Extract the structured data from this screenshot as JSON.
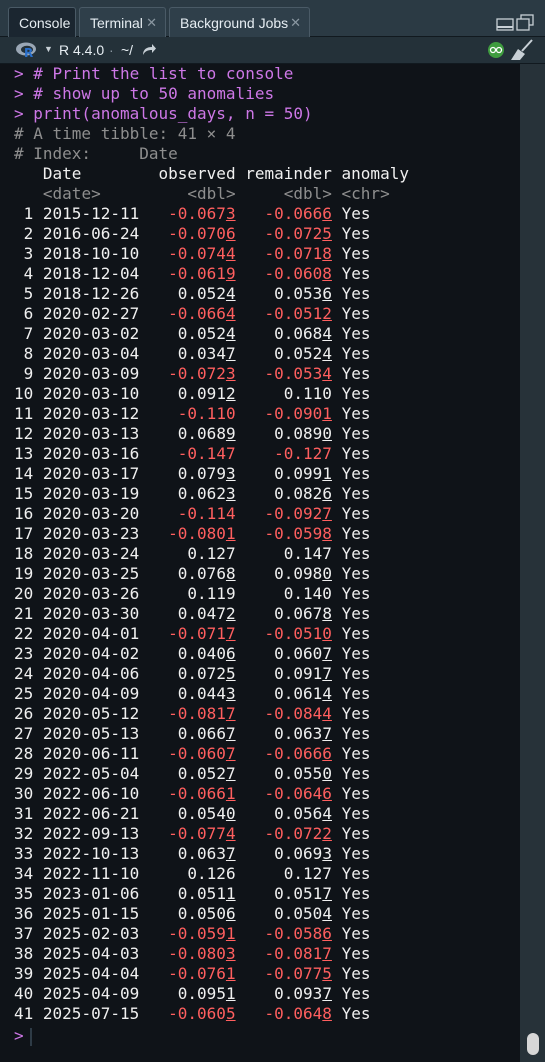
{
  "tabs": [
    {
      "label": "Console",
      "closable": false
    },
    {
      "label": "Terminal",
      "closable": true
    },
    {
      "label": "Background Jobs",
      "closable": true
    }
  ],
  "toolbar": {
    "version": "R 4.4.0",
    "separator": "·",
    "path": "~/"
  },
  "console": {
    "prompt": ">",
    "commands": [
      "# Print the list to console",
      "# show up to 50 anomalies",
      "print(anomalous_days, n = 50)"
    ],
    "meta": [
      "# A time tibble: 41 × 4",
      "# Index:     Date"
    ],
    "headers": [
      "Date",
      "observed",
      "remainder",
      "anomaly"
    ],
    "types": [
      "<date>",
      "<dbl>",
      "<dbl>",
      "<chr>"
    ],
    "rows": [
      [
        "2015-12-11",
        "-0.0673",
        "-0.0666",
        "Yes"
      ],
      [
        "2016-06-24",
        "-0.0706",
        "-0.0725",
        "Yes"
      ],
      [
        "2018-10-10",
        "-0.0744",
        "-0.0718",
        "Yes"
      ],
      [
        "2018-12-04",
        "-0.0619",
        "-0.0608",
        "Yes"
      ],
      [
        "2018-12-26",
        "0.0524",
        "0.0536",
        "Yes"
      ],
      [
        "2020-02-27",
        "-0.0664",
        "-0.0512",
        "Yes"
      ],
      [
        "2020-03-02",
        "0.0524",
        "0.0684",
        "Yes"
      ],
      [
        "2020-03-04",
        "0.0347",
        "0.0524",
        "Yes"
      ],
      [
        "2020-03-09",
        "-0.0723",
        "-0.0534",
        "Yes"
      ],
      [
        "2020-03-10",
        "0.0912",
        "0.110",
        "Yes"
      ],
      [
        "2020-03-12",
        "-0.110",
        "-0.0901",
        "Yes"
      ],
      [
        "2020-03-13",
        "0.0689",
        "0.0890",
        "Yes"
      ],
      [
        "2020-03-16",
        "-0.147",
        "-0.127",
        "Yes"
      ],
      [
        "2020-03-17",
        "0.0793",
        "0.0991",
        "Yes"
      ],
      [
        "2020-03-19",
        "0.0623",
        "0.0826",
        "Yes"
      ],
      [
        "2020-03-20",
        "-0.114",
        "-0.0927",
        "Yes"
      ],
      [
        "2020-03-23",
        "-0.0801",
        "-0.0598",
        "Yes"
      ],
      [
        "2020-03-24",
        "0.127",
        "0.147",
        "Yes"
      ],
      [
        "2020-03-25",
        "0.0768",
        "0.0980",
        "Yes"
      ],
      [
        "2020-03-26",
        "0.119",
        "0.140",
        "Yes"
      ],
      [
        "2020-03-30",
        "0.0472",
        "0.0678",
        "Yes"
      ],
      [
        "2020-04-01",
        "-0.0717",
        "-0.0510",
        "Yes"
      ],
      [
        "2020-04-02",
        "0.0406",
        "0.0607",
        "Yes"
      ],
      [
        "2020-04-06",
        "0.0725",
        "0.0917",
        "Yes"
      ],
      [
        "2020-04-09",
        "0.0443",
        "0.0614",
        "Yes"
      ],
      [
        "2020-05-12",
        "-0.0817",
        "-0.0844",
        "Yes"
      ],
      [
        "2020-05-13",
        "0.0667",
        "0.0637",
        "Yes"
      ],
      [
        "2020-06-11",
        "-0.0607",
        "-0.0666",
        "Yes"
      ],
      [
        "2022-05-04",
        "0.0527",
        "0.0550",
        "Yes"
      ],
      [
        "2022-06-10",
        "-0.0661",
        "-0.0646",
        "Yes"
      ],
      [
        "2022-06-21",
        "0.0540",
        "0.0564",
        "Yes"
      ],
      [
        "2022-09-13",
        "-0.0774",
        "-0.0722",
        "Yes"
      ],
      [
        "2022-10-13",
        "0.0637",
        "0.0693",
        "Yes"
      ],
      [
        "2022-11-10",
        "0.126",
        "0.127",
        "Yes"
      ],
      [
        "2023-01-06",
        "0.0511",
        "0.0517",
        "Yes"
      ],
      [
        "2025-01-15",
        "0.0506",
        "0.0504",
        "Yes"
      ],
      [
        "2025-02-03",
        "-0.0591",
        "-0.0586",
        "Yes"
      ],
      [
        "2025-04-03",
        "-0.0803",
        "-0.0817",
        "Yes"
      ],
      [
        "2025-04-04",
        "-0.0761",
        "-0.0775",
        "Yes"
      ],
      [
        "2025-04-09",
        "0.0951",
        "0.0937",
        "Yes"
      ],
      [
        "2025-07-15",
        "-0.0605",
        "-0.0648",
        "Yes"
      ]
    ]
  },
  "colors": {
    "prompt": "#cd77e6",
    "negative": "#ff5f5f",
    "muted": "#8e8e8e",
    "text": "#f0f0f0"
  },
  "icons": [
    "r-logo-icon",
    "dropdown-arrow-icon",
    "forward-arrow-icon",
    "minimize-icon",
    "maximize-icon",
    "eye-icon",
    "broom-icon"
  ]
}
